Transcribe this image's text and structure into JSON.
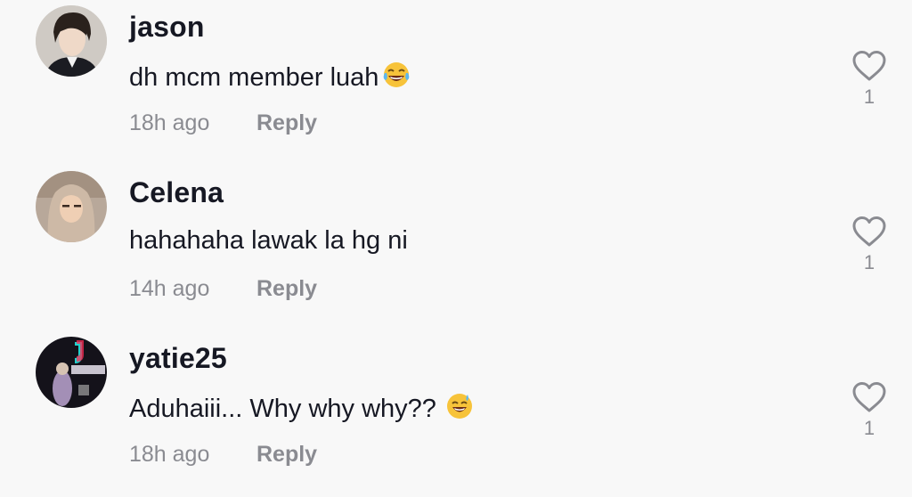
{
  "comments": [
    {
      "username": "jason",
      "text": "dh mcm member luah",
      "emoji_icon": "joy-emoji-icon",
      "time": "18h ago",
      "reply_label": "Reply",
      "likes": "1"
    },
    {
      "username": "Celena",
      "text": "hahahaha lawak la hg ni",
      "time": "14h ago",
      "reply_label": "Reply",
      "likes": "1"
    },
    {
      "username": "yatie25",
      "text": "Aduhaiii... Why why why??",
      "emoji_icon": "sweat-smile-emoji-icon",
      "time": "18h ago",
      "reply_label": "Reply",
      "likes": "1"
    }
  ],
  "colors": {
    "background": "#f8f8f8",
    "text": "#161823",
    "muted": "#8a8b91"
  }
}
